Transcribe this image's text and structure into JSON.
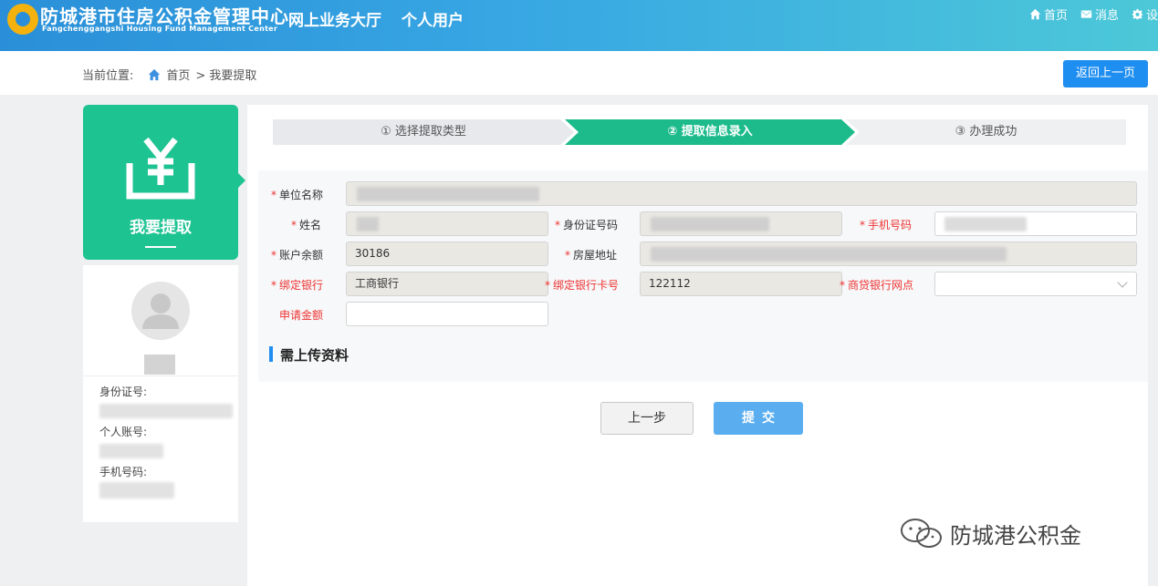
{
  "header": {
    "org_name": "防城港市住房公积金管理中心",
    "org_name_en": "Fangchenggangshi Housing Fund Management Center",
    "hall_title": "网上业务大厅",
    "user_type": "个人用户",
    "nav": {
      "home": "首页",
      "messages": "消息",
      "settings": "设"
    }
  },
  "breadcrumb": {
    "prefix": "当前位置:",
    "home": "首页",
    "current": "> 我要提取"
  },
  "back_button": "返回上一页",
  "left_card": {
    "title": "我要提取"
  },
  "profile": {
    "id_label": "身份证号:",
    "account_label": "个人账号:",
    "phone_label": "手机号码:"
  },
  "steps": [
    {
      "label": "① 选择提取类型",
      "state": "done"
    },
    {
      "label": "② 提取信息录入",
      "state": "active"
    },
    {
      "label": "③ 办理成功",
      "state": "pending"
    }
  ],
  "form": {
    "unit_name": {
      "label": "单位名称",
      "value": ""
    },
    "name": {
      "label": "姓名",
      "value": ""
    },
    "id_number": {
      "label": "身份证号码",
      "value": ""
    },
    "phone": {
      "label": "手机号码",
      "value": ""
    },
    "balance": {
      "label": "账户余额",
      "value": "30186"
    },
    "address": {
      "label": "房屋地址",
      "value": ""
    },
    "bound_bank": {
      "label": "绑定银行",
      "value": "工商银行"
    },
    "bound_card": {
      "label": "绑定银行卡号",
      "value": "122112"
    },
    "loan_branch": {
      "label": "商贷银行网点",
      "value": ""
    },
    "apply_amount": {
      "label": "申请金额",
      "value": ""
    }
  },
  "upload_section_title": "需上传资料",
  "buttons": {
    "prev": "上一步",
    "submit": "提交"
  },
  "watermark": "防城港公积金",
  "colors": {
    "accent_blue": "#1f8ef1",
    "accent_green": "#1dbb8b",
    "required_red": "#e33333"
  }
}
